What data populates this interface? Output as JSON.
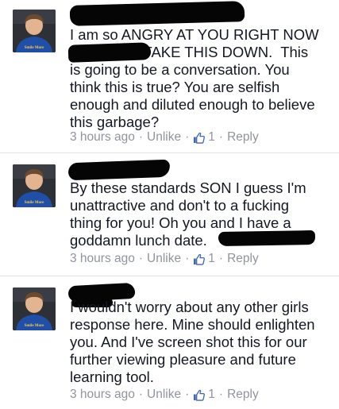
{
  "comments": [
    {
      "text": "I am so ANGRY AT YOU RIGHT NOW\n                  TAKE THIS DOWN.  This\nis going to be a conversation. You\nthink this is true? You are selfish\nenough and diluted enough to believe\nthis garbage?",
      "time": "3 hours ago",
      "unlike_label": "Unlike",
      "like_count": "1",
      "reply_label": "Reply",
      "avatar_caption": "Smile More"
    },
    {
      "text": "By these standards SON I guess I'm\nunattractive and don't to a fucking\nthing for you! Oh you and I have a\ngoddamn lunch date.",
      "time": "3 hours ago",
      "unlike_label": "Unlike",
      "like_count": "1",
      "reply_label": "Reply",
      "avatar_caption": "Smile More"
    },
    {
      "text": "I wouldn't worry about any other girls\nresponse here. Mine should enlighten\nyou. And I've screen shot this for our\nfurther viewing pleasure and future\nlearning tool.",
      "time": "3 hours ago",
      "unlike_label": "Unlike",
      "like_count": "1",
      "reply_label": "Reply",
      "avatar_caption": "Smile More"
    }
  ],
  "colors": {
    "text": "#141823",
    "meta": "#90949c",
    "like_blue": "#4267b2",
    "divider": "#e1e2e6",
    "redaction": "#050505"
  },
  "icons": {
    "like": "thumbs-up-icon",
    "avatar": "profile-photo"
  }
}
